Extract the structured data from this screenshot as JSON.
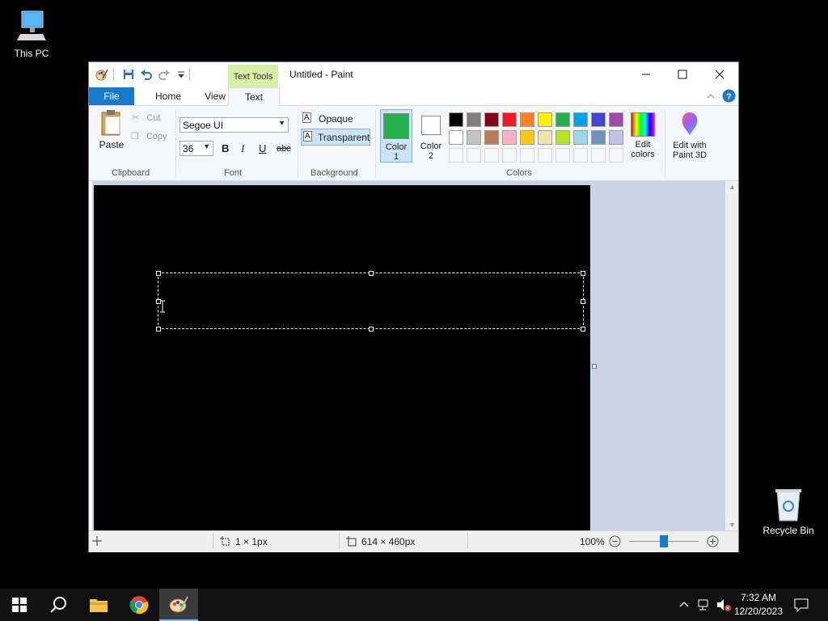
{
  "desktop": {
    "this_pc": "This PC",
    "recycle_bin": "Recycle Bin"
  },
  "window": {
    "title": "Untitled - Paint",
    "context_tab": "Text Tools"
  },
  "tabs": {
    "file": "File",
    "home": "Home",
    "view": "View",
    "text": "Text"
  },
  "clipboard": {
    "paste": "Paste",
    "cut": "Cut",
    "copy": "Copy",
    "group": "Clipboard"
  },
  "font": {
    "family": "Segoe UI",
    "size": "36",
    "bold": "B",
    "italic": "I",
    "underline": "U",
    "strike": "abc",
    "group": "Font"
  },
  "background": {
    "opaque": "Opaque",
    "transparent": "Transparent",
    "group": "Background"
  },
  "colors": {
    "color1": "Color 1",
    "color2": "Color 2",
    "edit_colors": "Edit colors",
    "group": "Colors",
    "color1_value": "#22b14c",
    "color2_value": "#ffffff",
    "palette_row1": [
      "#000000",
      "#7f7f7f",
      "#880015",
      "#ed1c24",
      "#ff7f27",
      "#fff200",
      "#22b14c",
      "#00a2e8",
      "#3f48cc",
      "#a349a4"
    ],
    "palette_row2": [
      "#ffffff",
      "#c3c3c3",
      "#b97a57",
      "#ffaec9",
      "#ffc90e",
      "#efe4b0",
      "#b5e61d",
      "#99d9ea",
      "#7092be",
      "#c8bfe7"
    ]
  },
  "paint3d": {
    "label": "Edit with Paint 3D"
  },
  "status": {
    "selection": "1 × 1px",
    "size": "614 × 460px",
    "zoom": "100%"
  },
  "taskbar": {
    "time": "7:32 AM",
    "date": "12/20/2023"
  }
}
